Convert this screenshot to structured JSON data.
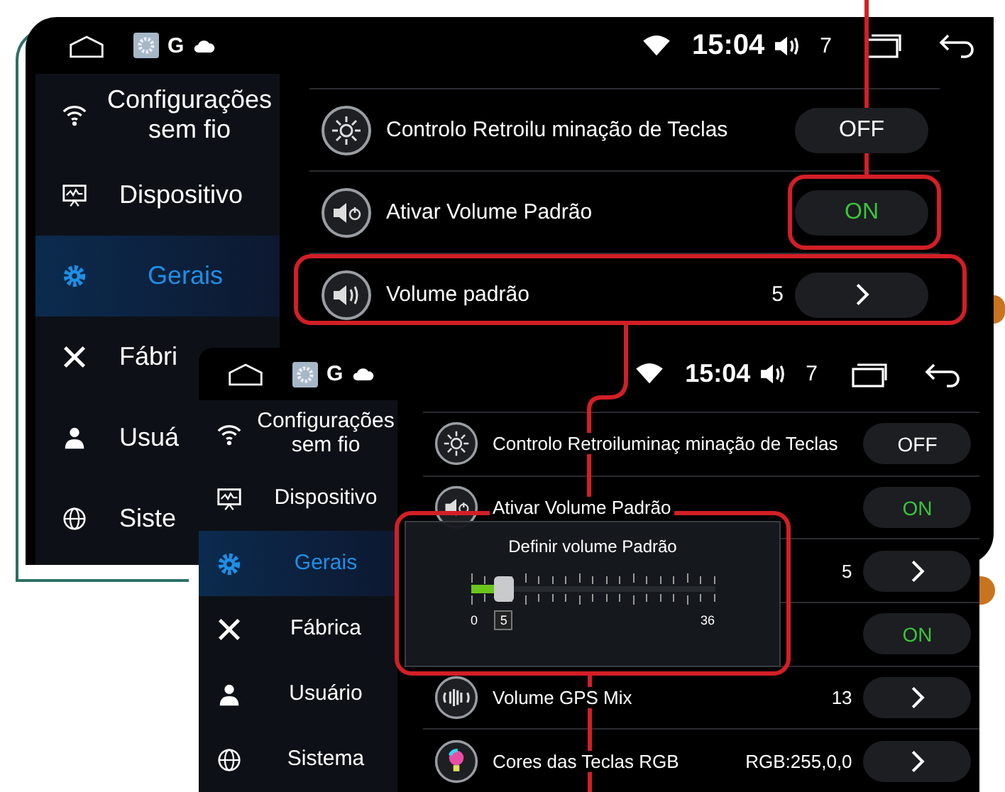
{
  "back_screen": {
    "status_bar": {
      "app_letter": "G",
      "time": "15:04",
      "volume": "7"
    },
    "sidebar": [
      {
        "label": "Configurações sem fio",
        "selected": false
      },
      {
        "label": "Dispositivo",
        "selected": false
      },
      {
        "label": "Gerais",
        "selected": true
      },
      {
        "label": "Fábri",
        "selected": false
      },
      {
        "label": "Usuá",
        "selected": false
      },
      {
        "label": "Siste",
        "selected": false
      }
    ],
    "rows": [
      {
        "kind": "toggle",
        "label": "Controlo Retroilu minação de Teclas",
        "value": "OFF",
        "on": false
      },
      {
        "kind": "toggle",
        "label": "Ativar Volume Padrão",
        "value": "ON",
        "on": true
      },
      {
        "kind": "link",
        "label": "Volume padrão",
        "value": "5"
      }
    ]
  },
  "front_screen": {
    "status_bar": {
      "app_letter": "G",
      "time": "15:04",
      "volume": "7"
    },
    "sidebar": [
      {
        "label": "Configurações sem fio",
        "selected": false
      },
      {
        "label": "Dispositivo",
        "selected": false
      },
      {
        "label": "Gerais",
        "selected": true
      },
      {
        "label": "Fábrica",
        "selected": false
      },
      {
        "label": "Usuário",
        "selected": false
      },
      {
        "label": "Sistema",
        "selected": false
      }
    ],
    "rows": [
      {
        "kind": "toggle",
        "label": "Controlo Retroiluminaç minação de Teclas",
        "value": "OFF",
        "on": false
      },
      {
        "kind": "toggle",
        "label": "Ativar Volume Padrão",
        "value": "ON",
        "on": true
      },
      {
        "kind": "link",
        "value": "5"
      },
      {
        "kind": "toggle",
        "value": "ON",
        "on": true
      },
      {
        "kind": "link",
        "label": "Volume GPS Mix",
        "value": "13"
      },
      {
        "kind": "link",
        "label": "Cores das Teclas RGB",
        "value": "RGB:255,0,0"
      }
    ],
    "dialog": {
      "title": "Definir volume Padrão",
      "min_label": "0",
      "max_label": "36",
      "value_label": "5",
      "level": 0.139
    }
  }
}
